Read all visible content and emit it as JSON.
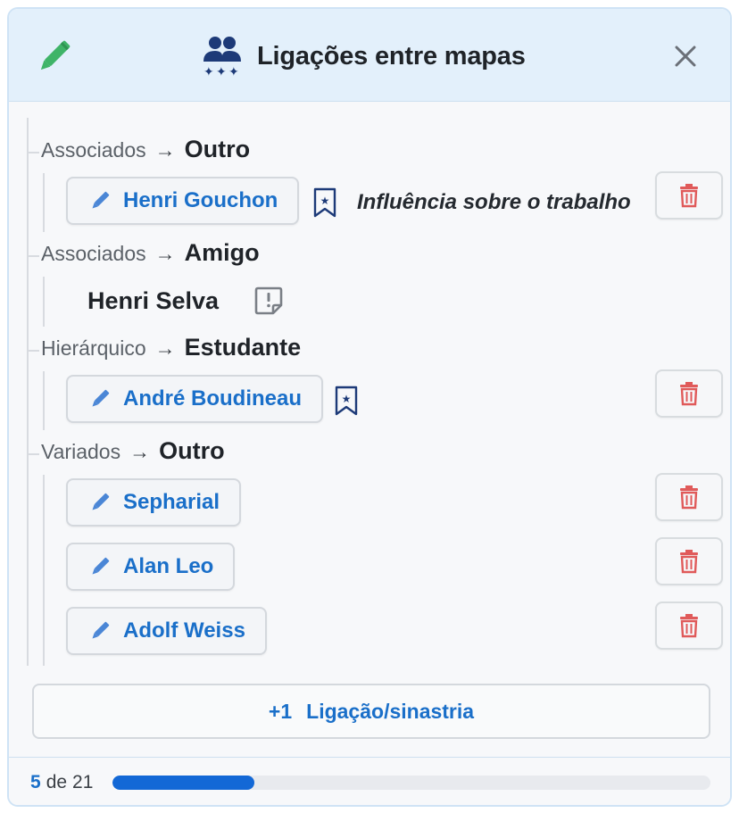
{
  "header": {
    "title": "Ligações entre mapas",
    "edit_icon": "pencil-icon",
    "title_icon": "users-stars-icon",
    "close_icon": "close-icon"
  },
  "groups": [
    {
      "category": "Associados",
      "arrow": "→",
      "relation": "Outro",
      "entries": [
        {
          "name": "Henri Gouchon",
          "editable": true,
          "bookmark": true,
          "note": "Influência sobre o trabalho",
          "deletable": true
        }
      ]
    },
    {
      "category": "Associados",
      "arrow": "→",
      "relation": "Amigo",
      "entries": [
        {
          "name": "Henri Selva",
          "editable": false,
          "note_icon": "note-alert-icon"
        }
      ]
    },
    {
      "category": "Hierárquico",
      "arrow": "→",
      "relation": "Estudante",
      "entries": [
        {
          "name": "André Boudineau",
          "editable": true,
          "bookmark": true,
          "deletable": true
        }
      ]
    },
    {
      "category": "Variados",
      "arrow": "→",
      "relation": "Outro",
      "entries": [
        {
          "name": "Sepharial",
          "editable": true,
          "deletable": true
        },
        {
          "name": "Alan Leo",
          "editable": true,
          "deletable": true
        },
        {
          "name": "Adolf Weiss",
          "editable": true,
          "deletable": true
        }
      ]
    }
  ],
  "add_button": {
    "prefix": "+1",
    "label": "Ligação/sinastria"
  },
  "footer": {
    "current": "5",
    "of_label": "de",
    "total": "21",
    "progress_fraction": 0.238
  },
  "colors": {
    "accent": "#1a6fc9",
    "pencil": "#3fb468",
    "delete": "#e05a5a",
    "title_icon": "#1d3a78",
    "progress": "#1368d6"
  }
}
